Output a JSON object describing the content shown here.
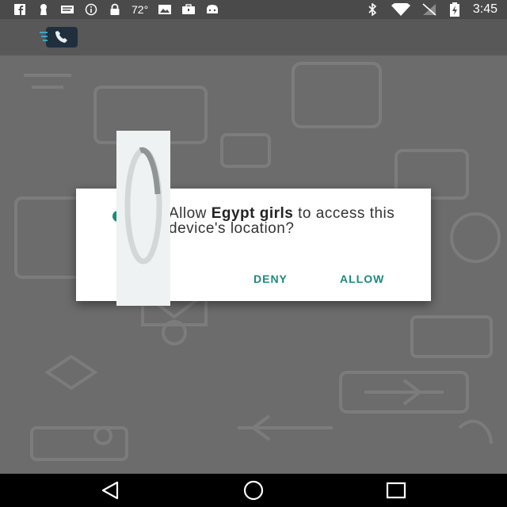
{
  "status_bar": {
    "icons_left": [
      "facebook-icon",
      "keyhole-icon",
      "message-icon",
      "info-icon",
      "lock-icon"
    ],
    "temperature": "72°",
    "icons_left_2": [
      "photo-icon",
      "bag-icon",
      "android-icon"
    ],
    "icons_right": [
      "bluetooth-icon",
      "wifi-icon",
      "signal-icon",
      "battery-icon"
    ],
    "time": "3:45"
  },
  "toolbar": {
    "icon": "phone-app-icon"
  },
  "dialog": {
    "message_before": "Allow ",
    "app_name": "Egypt girls",
    "message_after": " to access this device's location?",
    "deny_label": "DENY",
    "allow_label": "ALLOW",
    "accent": "#1c8a7e"
  },
  "overlay": {
    "icon": "loading-spinner-icon"
  },
  "nav_bar": {
    "back": "back-icon",
    "home": "home-icon",
    "recents": "recents-icon"
  }
}
